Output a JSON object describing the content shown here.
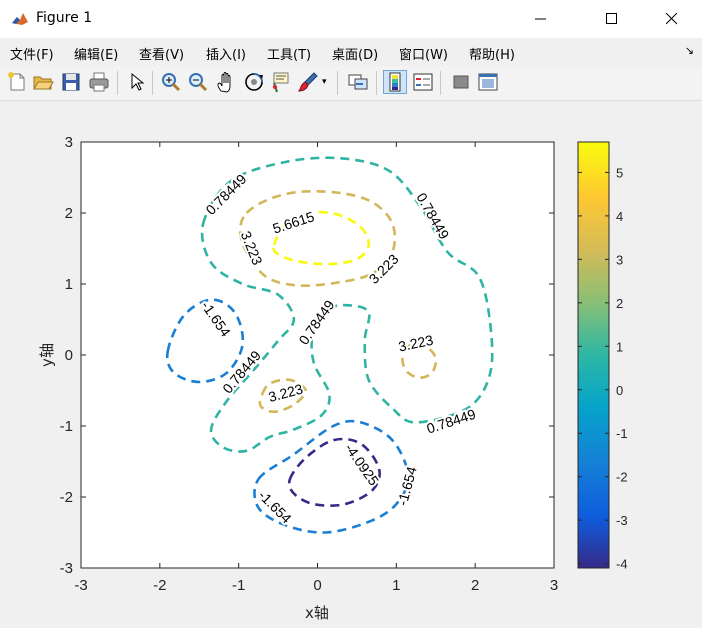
{
  "window": {
    "title": "Figure 1",
    "controls": [
      "minimize",
      "maximize",
      "close"
    ]
  },
  "menu": {
    "items": [
      "文件(F)",
      "编辑(E)",
      "查看(V)",
      "插入(I)",
      "工具(T)",
      "桌面(D)",
      "窗口(W)",
      "帮助(H)"
    ]
  },
  "toolbar": {
    "buttons": [
      "new-figure-icon",
      "open-icon",
      "save-icon",
      "print-icon",
      "pointer-icon",
      "zoom-in-icon",
      "zoom-out-icon",
      "pan-icon",
      "rotate-3d-icon",
      "data-cursor-icon",
      "brush-icon",
      "link-plot-icon",
      "colorbar-icon",
      "legend-icon",
      "hide-plot-tools-icon",
      "show-plot-tools-icon"
    ]
  },
  "chart_data": {
    "type": "contour",
    "xlabel": "x轴",
    "ylabel": "y轴",
    "xlim": [
      -3,
      3
    ],
    "ylim": [
      -3,
      3
    ],
    "xticks": [
      "-3",
      "-2",
      "-1",
      "0",
      "1",
      "2",
      "3"
    ],
    "yticks": [
      "-3",
      "-2",
      "-1",
      "0",
      "1",
      "2",
      "3"
    ],
    "grid": false,
    "line_style": "dashed",
    "colormap": "parula",
    "colors": {
      "-4.0925": "#352a87",
      "-1.654": "#1a7fd4",
      "0.78449": "#2fb4a4",
      "3.223": "#d4b65a",
      "5.6615": "#f9f90e"
    },
    "colorbar": {
      "range": [
        -4.1,
        5.7
      ],
      "ticks": [
        "-4",
        "-3",
        "-2",
        "-1",
        "0",
        "1",
        "2",
        "3",
        "4",
        "5"
      ]
    },
    "levels": [
      {
        "level": 5.6615,
        "label": "5.6615",
        "contours": [
          [
            [
              -0.55,
              1.55
            ],
            [
              -0.4,
              1.85
            ],
            [
              -0.1,
              2.0
            ],
            [
              0.25,
              1.98
            ],
            [
              0.55,
              1.8
            ],
            [
              0.65,
              1.55
            ],
            [
              0.5,
              1.35
            ],
            [
              0.15,
              1.28
            ],
            [
              -0.25,
              1.32
            ],
            [
              -0.5,
              1.42
            ],
            [
              -0.55,
              1.55
            ]
          ]
        ]
      },
      {
        "level": 3.223,
        "label": "3.223",
        "contours": [
          [
            [
              -0.9,
              2.0
            ],
            [
              -0.6,
              2.2
            ],
            [
              -0.2,
              2.3
            ],
            [
              0.3,
              2.28
            ],
            [
              0.7,
              2.15
            ],
            [
              0.95,
              1.85
            ],
            [
              0.95,
              1.45
            ],
            [
              0.7,
              1.15
            ],
            [
              0.25,
              1.02
            ],
            [
              -0.25,
              0.98
            ],
            [
              -0.65,
              1.1
            ],
            [
              -0.9,
              1.45
            ],
            [
              -0.98,
              1.75
            ],
            [
              -0.9,
              2.0
            ]
          ],
          [
            [
              1.1,
              0.05
            ],
            [
              1.2,
              0.15
            ],
            [
              1.38,
              0.12
            ],
            [
              1.5,
              -0.05
            ],
            [
              1.45,
              -0.25
            ],
            [
              1.3,
              -0.32
            ],
            [
              1.15,
              -0.25
            ],
            [
              1.08,
              -0.1
            ],
            [
              1.1,
              0.05
            ]
          ],
          [
            [
              -0.7,
              -0.55
            ],
            [
              -0.6,
              -0.4
            ],
            [
              -0.35,
              -0.35
            ],
            [
              -0.15,
              -0.5
            ],
            [
              -0.3,
              -0.7
            ],
            [
              -0.55,
              -0.8
            ],
            [
              -0.72,
              -0.72
            ],
            [
              -0.7,
              -0.55
            ]
          ]
        ]
      },
      {
        "level": 0.78449,
        "label": "0.78449",
        "contours": [
          [
            [
              -1.45,
              1.85
            ],
            [
              -1.1,
              2.45
            ],
            [
              -0.4,
              2.72
            ],
            [
              0.3,
              2.77
            ],
            [
              0.9,
              2.6
            ],
            [
              1.3,
              2.1
            ],
            [
              1.65,
              1.45
            ],
            [
              2.05,
              1.1
            ],
            [
              2.2,
              0.35
            ],
            [
              2.18,
              -0.3
            ],
            [
              1.9,
              -0.75
            ],
            [
              1.25,
              -0.95
            ],
            [
              0.95,
              -0.75
            ],
            [
              0.65,
              -0.35
            ],
            [
              0.6,
              0.2
            ],
            [
              0.65,
              0.6
            ],
            [
              0.4,
              0.7
            ],
            [
              0.15,
              0.65
            ],
            [
              -0.05,
              0.35
            ],
            [
              -0.05,
              -0.1
            ],
            [
              0.15,
              -0.55
            ],
            [
              0.05,
              -0.85
            ],
            [
              -0.3,
              -1.05
            ],
            [
              -0.6,
              -1.15
            ],
            [
              -0.9,
              -1.35
            ],
            [
              -1.2,
              -1.3
            ],
            [
              -1.35,
              -1.05
            ],
            [
              -1.15,
              -0.65
            ],
            [
              -0.8,
              -0.2
            ],
            [
              -0.5,
              0.2
            ],
            [
              -0.3,
              0.5
            ],
            [
              -0.5,
              0.85
            ],
            [
              -0.95,
              1.0
            ],
            [
              -1.35,
              1.3
            ],
            [
              -1.45,
              1.85
            ]
          ]
        ]
      },
      {
        "level": -1.654,
        "label": "-1.654",
        "contours": [
          [
            [
              -1.9,
              0.05
            ],
            [
              -1.7,
              0.55
            ],
            [
              -1.35,
              0.78
            ],
            [
              -1.05,
              0.6
            ],
            [
              -0.95,
              0.15
            ],
            [
              -1.15,
              -0.25
            ],
            [
              -1.5,
              -0.38
            ],
            [
              -1.82,
              -0.25
            ],
            [
              -1.9,
              0.05
            ]
          ],
          [
            [
              -0.75,
              -1.75
            ],
            [
              -0.3,
              -1.4
            ],
            [
              0.2,
              -1.0
            ],
            [
              0.55,
              -0.95
            ],
            [
              0.95,
              -1.2
            ],
            [
              1.15,
              -1.7
            ],
            [
              1.0,
              -2.1
            ],
            [
              0.65,
              -2.35
            ],
            [
              0.1,
              -2.5
            ],
            [
              -0.4,
              -2.4
            ],
            [
              -0.75,
              -2.15
            ],
            [
              -0.75,
              -1.75
            ]
          ]
        ]
      },
      {
        "level": -4.0925,
        "label": "-4.0925",
        "contours": [
          [
            [
              -0.35,
              -1.75
            ],
            [
              -0.15,
              -1.45
            ],
            [
              0.2,
              -1.2
            ],
            [
              0.55,
              -1.25
            ],
            [
              0.78,
              -1.6
            ],
            [
              0.7,
              -1.9
            ],
            [
              0.35,
              -2.1
            ],
            [
              -0.05,
              -2.1
            ],
            [
              -0.3,
              -1.95
            ],
            [
              -0.35,
              -1.75
            ]
          ]
        ]
      }
    ],
    "labels": [
      {
        "text": "0.78449",
        "x": -1.15,
        "y": 2.25,
        "angle": -45,
        "level": 0.78449
      },
      {
        "text": "0.78449",
        "x": 1.45,
        "y": 1.95,
        "angle": 60,
        "level": 0.78449
      },
      {
        "text": "5.6615",
        "x": -0.3,
        "y": 1.85,
        "angle": -18,
        "level": 5.6615
      },
      {
        "text": "3.223",
        "x": -0.85,
        "y": 1.5,
        "angle": 68,
        "level": 3.223
      },
      {
        "text": "3.223",
        "x": 0.85,
        "y": 1.2,
        "angle": -45,
        "level": 3.223
      },
      {
        "text": "-1.654",
        "x": -1.3,
        "y": 0.5,
        "angle": 55,
        "level": -1.654
      },
      {
        "text": "0.78449",
        "x": 0.0,
        "y": 0.45,
        "angle": -55,
        "level": 0.78449
      },
      {
        "text": "3.223",
        "x": 1.25,
        "y": 0.15,
        "angle": -12,
        "level": 3.223
      },
      {
        "text": "0.78449",
        "x": -0.95,
        "y": -0.25,
        "angle": -50,
        "level": 0.78449
      },
      {
        "text": "3.223",
        "x": -0.4,
        "y": -0.55,
        "angle": -15,
        "level": 3.223
      },
      {
        "text": "0.78449",
        "x": 1.7,
        "y": -0.95,
        "angle": -18,
        "level": 0.78449
      },
      {
        "text": "-4.0925",
        "x": 0.55,
        "y": -1.55,
        "angle": 55,
        "level": -4.0925
      },
      {
        "text": "-1.654",
        "x": 1.15,
        "y": -1.85,
        "angle": -75,
        "level": -1.654
      },
      {
        "text": "-1.654",
        "x": -0.55,
        "y": -2.15,
        "angle": 45,
        "level": -1.654
      }
    ]
  }
}
